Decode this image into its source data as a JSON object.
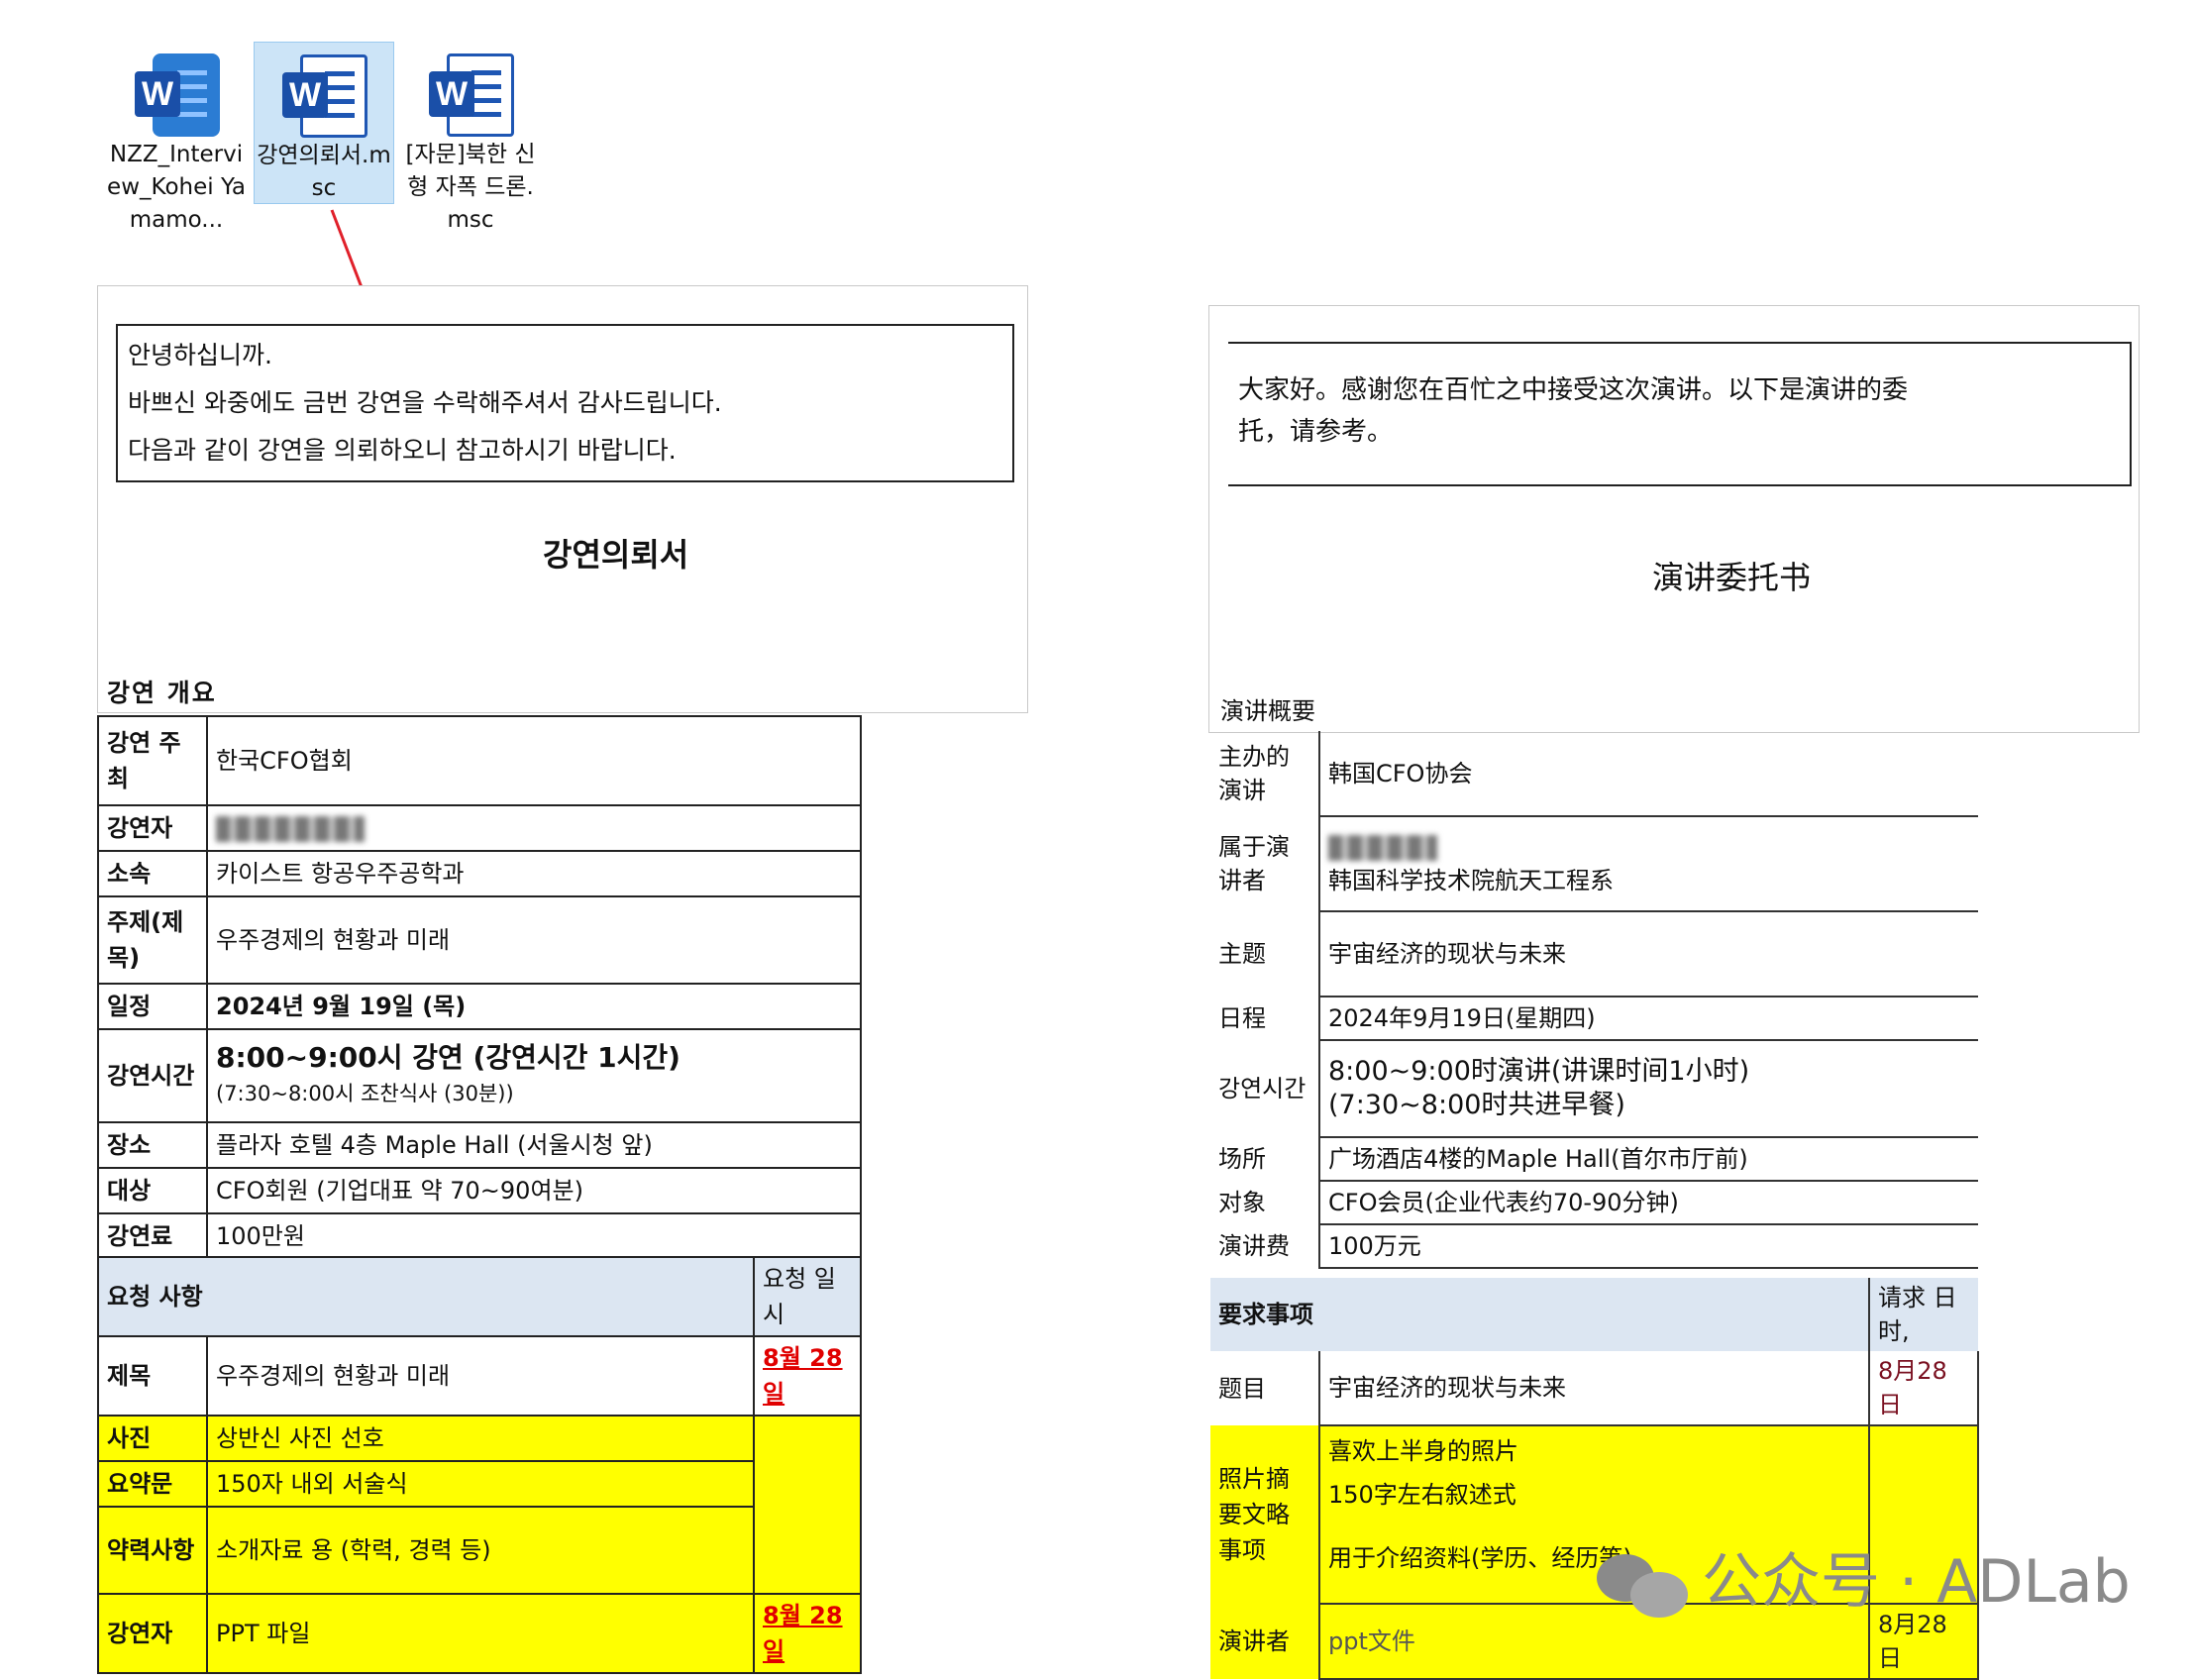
{
  "desktop": {
    "icons": [
      {
        "label": "NZZ_Interview_Kohei Yamamo...",
        "selected": false
      },
      {
        "label": "강연의뢰서.msc",
        "selected": true
      },
      {
        "label": "[자문]북한 신형 자폭 드론.msc",
        "selected": false
      }
    ]
  },
  "korean_doc": {
    "greeting": [
      "안녕하십니까.",
      "바쁘신 와중에도 금번 강연을 수락해주셔서 감사드립니다.",
      "다음과 같이 강연을 의뢰하오니 참고하시기 바랍니다."
    ],
    "title": "강연의뢰서",
    "section_overview": "강연 개요",
    "rows": [
      {
        "label": "강연 주최",
        "value": "한국CFO협회"
      },
      {
        "label": "강연자",
        "value": ""
      },
      {
        "label": "소속",
        "value": "카이스트 항공우주공학과"
      },
      {
        "label": "주제(제목)",
        "value": "우주경제의 현황과 미래"
      },
      {
        "label": "일정",
        "value": "2024년 9월 19일 (목)"
      },
      {
        "label": "강연시간",
        "value": "8:00~9:00시 강연 (강연시간 1시간)",
        "value2": "(7:30~8:00시 조찬식사 (30분))"
      },
      {
        "label": "장소",
        "value": "플라자 호텔 4층 Maple Hall (서울시청 앞)"
      },
      {
        "label": "대상",
        "value": "CFO회원 (기업대표 약 70~90여분)"
      },
      {
        "label": "강연료",
        "value": "100만원"
      }
    ],
    "request_header": "요청 사항",
    "request_date_header": "요청 일시",
    "requests": [
      {
        "label": "제목",
        "value": "우주경제의 현황과 미래",
        "date": "8월 28일"
      },
      {
        "label": "사진",
        "value": "상반신 사진 선호",
        "date": ""
      },
      {
        "label": "요약문",
        "value": "150자 내외 서술식",
        "date": ""
      },
      {
        "label": "약력사항",
        "value": "소개자료 용 (학력, 경력 등)",
        "date": ""
      },
      {
        "label": "강연자",
        "value": "PPT 파일",
        "date": "8월 28일"
      }
    ]
  },
  "chinese_doc": {
    "greeting": [
      "大家好。感谢您在百忙之中接受这次演讲。以下是演讲的委",
      "托，请参考。"
    ],
    "title": "演讲委托书",
    "section_overview": "演讲概要",
    "rows": [
      {
        "label": "主办的演讲",
        "value": "韩国CFO协会"
      },
      {
        "label": "属于演讲者",
        "value": "韩国科学技术院航天工程系"
      },
      {
        "label": "主题",
        "value": "宇宙经济的现状与未来"
      },
      {
        "label": "日程",
        "value": "2024年9月19日(星期四)"
      },
      {
        "label": "강연시간",
        "value": "8:00~9:00时演讲(讲课时间1小时)",
        "value2": "(7:30~8:00时共进早餐)"
      },
      {
        "label": "场所",
        "value": "广场酒店4楼的Maple Hall(首尔市厅前)"
      },
      {
        "label": "对象",
        "value": "CFO会员(企业代表约70-90分钟)"
      },
      {
        "label": "演讲费",
        "value": "100万元"
      }
    ],
    "request_header": "要求事项",
    "request_date_header": "请求 日时,",
    "requests": [
      {
        "label": "题目",
        "value": "宇宙经济的现状与未来",
        "date": "8月28日"
      },
      {
        "label": "照片摘要文略事项",
        "value": "喜欢上半身的照片",
        "value2": "150字左右叙述式",
        "value3": "用于介绍资料(学历、经历等)"
      },
      {
        "label": "演讲者",
        "value": "ppt文件",
        "date": "8月28日"
      }
    ]
  },
  "watermark": "公众号 · ADLab",
  "colors": {
    "highlight": "#ffff00",
    "header": "#dce6f2",
    "arrow": "#e0202a",
    "due": "#e00000",
    "selection": "#cce4f7"
  }
}
